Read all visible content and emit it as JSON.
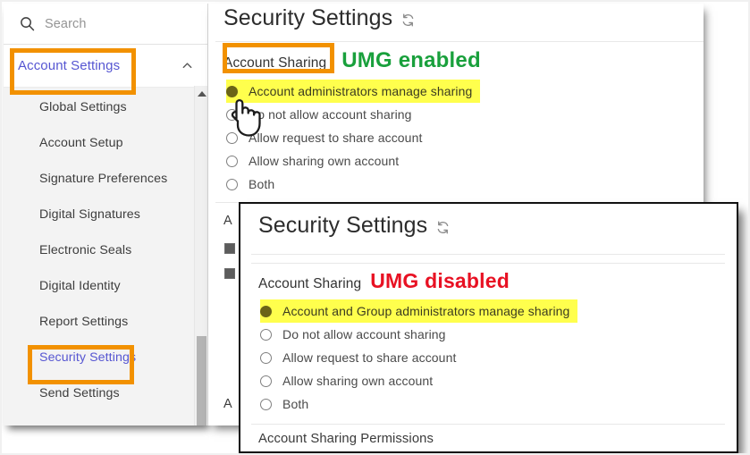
{
  "search": {
    "placeholder": "Search",
    "icon": "search-icon"
  },
  "sidebar": {
    "group_label": "Account Settings",
    "collapse_icon": "chevron-up-icon",
    "items": [
      {
        "label": "Global Settings",
        "selected": false
      },
      {
        "label": "Account Setup",
        "selected": false
      },
      {
        "label": "Signature Preferences",
        "selected": false
      },
      {
        "label": "Digital Signatures",
        "selected": false
      },
      {
        "label": "Electronic Seals",
        "selected": false
      },
      {
        "label": "Digital Identity",
        "selected": false
      },
      {
        "label": "Report Settings",
        "selected": false
      },
      {
        "label": "Security Settings",
        "selected": true
      },
      {
        "label": "Send Settings",
        "selected": false
      }
    ],
    "scrollbar": {
      "up_arrow": "scroll-up-arrow-icon"
    }
  },
  "back_panel": {
    "title": "Security Settings",
    "refresh_icon": "refresh-icon",
    "section_label": "Account Sharing",
    "annotation": "UMG enabled",
    "annotation_color": "#19a03c",
    "options": [
      {
        "label": "Account administrators manage sharing",
        "checked": true,
        "highlighted": true
      },
      {
        "label": "Do not allow account sharing",
        "checked": false,
        "highlighted": false
      },
      {
        "label": "Allow request to share account",
        "checked": false,
        "highlighted": false
      },
      {
        "label": "Allow sharing own account",
        "checked": false,
        "highlighted": false
      },
      {
        "label": "Both",
        "checked": false,
        "highlighted": false
      }
    ],
    "obscured_label": "A",
    "obscured_label_2": "A"
  },
  "front_panel": {
    "title": "Security Settings",
    "refresh_icon": "refresh-icon",
    "section_label": "Account Sharing",
    "annotation": "UMG disabled",
    "annotation_color": "#e81123",
    "options": [
      {
        "label": "Account and Group administrators manage sharing",
        "checked": true,
        "highlighted": true
      },
      {
        "label": "Do not allow account sharing",
        "checked": false,
        "highlighted": false
      },
      {
        "label": "Allow request to share account",
        "checked": false,
        "highlighted": false
      },
      {
        "label": "Allow sharing own account",
        "checked": false,
        "highlighted": false
      },
      {
        "label": "Both",
        "checked": false,
        "highlighted": false
      }
    ],
    "footer_label": "Account Sharing Permissions"
  },
  "annotations": {
    "highlight_color": "#f29100",
    "highlight_boxes": [
      "account-settings-nav-group",
      "security-settings-nav-item",
      "account-sharing-section-label"
    ]
  },
  "cursor": {
    "icon": "pointing-hand-cursor"
  }
}
